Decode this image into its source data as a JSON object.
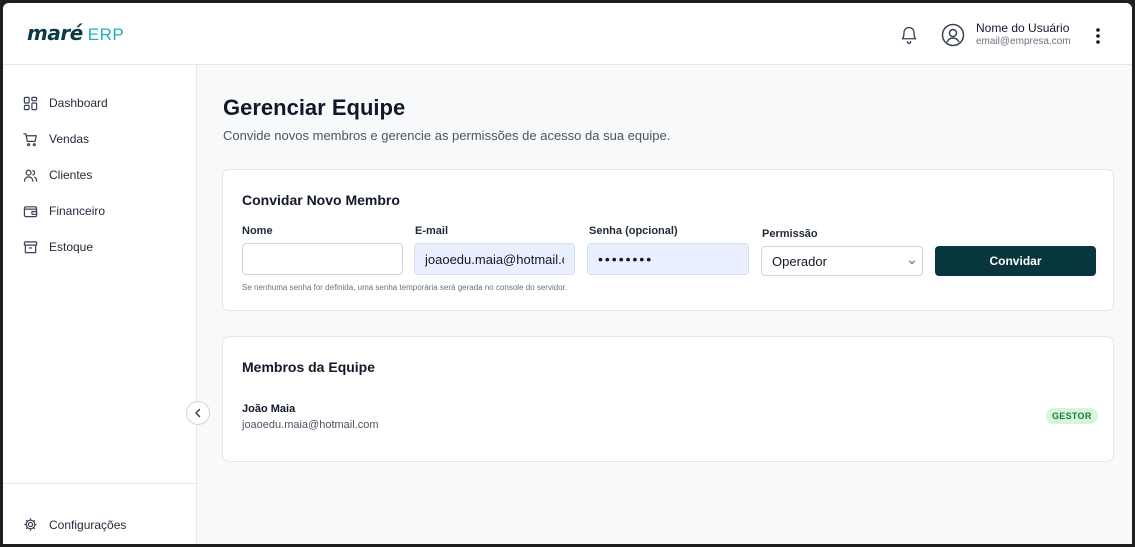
{
  "brand": {
    "name": "maré",
    "suffix": "ERP"
  },
  "header": {
    "user_name": "Nome do Usuário",
    "user_email": "email@empresa.com"
  },
  "sidebar": {
    "items": [
      {
        "label": "Dashboard",
        "icon": "dashboard-grid-icon"
      },
      {
        "label": "Vendas",
        "icon": "cart-icon"
      },
      {
        "label": "Clientes",
        "icon": "users-icon"
      },
      {
        "label": "Financeiro",
        "icon": "wallet-icon"
      },
      {
        "label": "Estoque",
        "icon": "archive-icon"
      }
    ],
    "settings_label": "Configurações"
  },
  "page": {
    "title": "Gerenciar Equipe",
    "subtitle": "Convide novos membros e gerencie as permissões de acesso da sua equipe."
  },
  "invite": {
    "title": "Convidar Novo Membro",
    "name_label": "Nome",
    "name_value": "",
    "email_label": "E-mail",
    "email_value": "joaoedu.maia@hotmail.c",
    "password_label": "Senha (opcional)",
    "password_value": "••••••••",
    "permission_label": "Permissão",
    "permission_value": "Operador",
    "submit_label": "Convidar",
    "help_text": "Se nenhuma senha for definida, uma senha temporária será gerada no console do servidor."
  },
  "members": {
    "title": "Membros da Equipe",
    "list": [
      {
        "name": "João Maia",
        "email": "joaoedu.maia@hotmail.com",
        "role": "GESTOR"
      }
    ]
  },
  "colors": {
    "brand_dark": "#0b3b45",
    "brand_accent": "#22b0b8",
    "button": "#08363f",
    "badge_bg": "#d7f4df",
    "badge_text": "#15803d"
  }
}
